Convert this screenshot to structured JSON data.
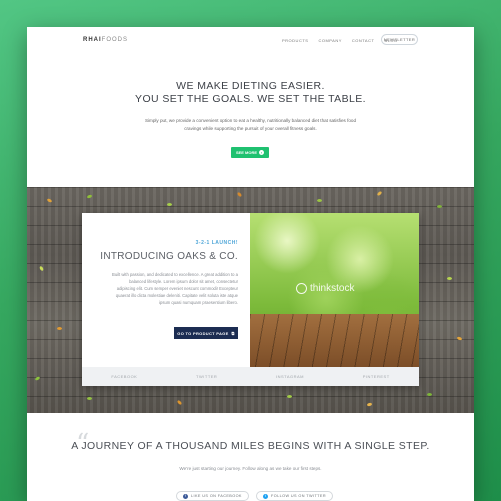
{
  "brand": {
    "logo_bold": "RHAI",
    "logo_light": "FOODS"
  },
  "nav": {
    "links": [
      "PRODUCTS",
      "COMPANY",
      "CONTACT",
      "BLOG"
    ],
    "newsletter_label": "NEWSLETTER"
  },
  "hero": {
    "title_line1": "WE MAKE DIETING EASIER.",
    "title_line2": "YOU SET THE GOALS. WE SET THE TABLE.",
    "subtitle": "Simply put, we provide a convenient option to eat a healthy, nutritionally balanced diet that satisfies food cravings while supporting the pursuit of your overall fitness goals.",
    "cta_label": "SEE MORE"
  },
  "feature": {
    "eyebrow": "3-2-1 LAUNCH!",
    "title": "INTRODUCING OAKS & CO.",
    "body": "Built with passion, and dedicated to excellence. A great addition to a balanced lifestyle. Lorem ipsum dolor sit amet, consectetur adipiscing elit. Cum semper eveniet nescunt commodi! Excepteur quaerat illo dicta molestiae deleniti. Capitate velit soluta iste atque ipsum quasi numquam praesentium libero.",
    "button_label": "GO TO PRODUCT PAGE",
    "watermark": "thinkstock",
    "footer_links": [
      "FACEBOOK",
      "TWITTER",
      "INSTAGRAM",
      "PINTEREST"
    ]
  },
  "quote": {
    "text": "A JOURNEY OF A THOUSAND MILES BEGINS WITH A SINGLE STEP.",
    "subtitle": "We're just starting our journey. Follow along as we take our first steps.",
    "facebook_label": "LIKE US ON FACEBOOK",
    "twitter_label": "FOLLOW US ON TWITTER"
  },
  "colors": {
    "background": "#36a860",
    "accent_green": "#1fc170",
    "navy": "#1c2d52",
    "eyebrow_blue": "#4fa6d8",
    "facebook_blue": "#3b5998",
    "twitter_blue": "#1da1f2"
  }
}
